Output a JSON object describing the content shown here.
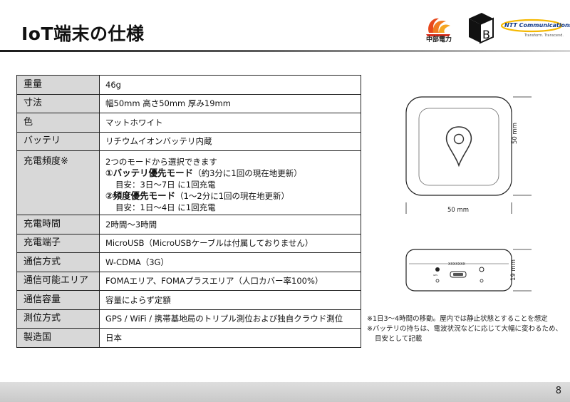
{
  "title": "IoT端末の仕様",
  "logos": {
    "chubu_text": "中部電力",
    "b_mark": "B",
    "ntt_name": "NTT Communications",
    "ntt_tagline": "Transform. Transcend."
  },
  "spec_rows": [
    {
      "key": "重量",
      "value": "46g"
    },
    {
      "key": "寸法",
      "value": "幅50mm 高さ50mm 厚み19mm"
    },
    {
      "key": "色",
      "value": "マットホワイト"
    },
    {
      "key": "バッテリ",
      "value": "リチウムイオンバッテリ内蔵"
    },
    {
      "key": "充電頻度※",
      "value": {
        "intro": "2つのモードから選択できます",
        "mode1_title": "①バッテリ優先モード",
        "mode1_paren": "（約3分に1回の現在地更新）",
        "mode1_detail": "目安：3日～7日 に1回充電",
        "mode2_title": "②頻度優先モード",
        "mode2_paren": "（1～2分に1回の現在地更新）",
        "mode2_detail": "目安：1日～4日 に1回充電"
      }
    },
    {
      "key": "充電時間",
      "value": "2時間～3時間"
    },
    {
      "key": "充電端子",
      "value": "MicroUSB（MicroUSBケーブルは付属しておりません）"
    },
    {
      "key": "通信方式",
      "value": "W-CDMA（3G）"
    },
    {
      "key": "通信可能エリア",
      "value": "FOMAエリア、FOMAプラスエリア（人口カバー率100%）"
    },
    {
      "key": "通信容量",
      "value": "容量によらず定額"
    },
    {
      "key": "測位方式",
      "value": "GPS / WiFi / 携帯基地局のトリプル測位および独自クラウド測位"
    },
    {
      "key": "製造国",
      "value": "日本"
    }
  ],
  "device": {
    "width_label": "50 mm",
    "height_label": "50 mm",
    "thickness_label": "19 mm",
    "side_label": "XXXXXXX"
  },
  "notes": {
    "note1": "※1日3～4時間の移動。屋内では静止状態とすることを想定",
    "note2": "※バッテリの持ちは、電波状況などに応じて大幅に変わるため、",
    "note2b": "目安として記載"
  },
  "page_number": "8",
  "colors": {
    "key_cell_bg": "#d8d8d8",
    "border": "#222222",
    "ntt_blue": "#143c8c",
    "chubu_orange": "#e8481c"
  }
}
